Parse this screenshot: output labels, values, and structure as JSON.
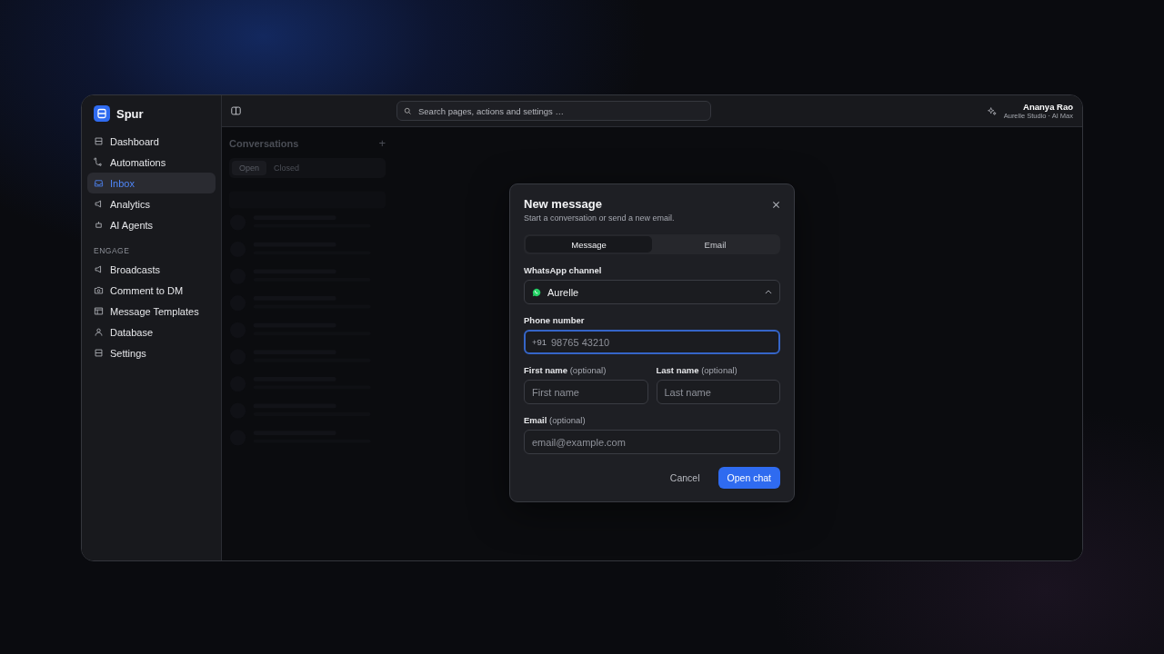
{
  "brand": {
    "name": "Spur"
  },
  "sidebar": {
    "items": [
      {
        "label": "Dashboard",
        "selected": false
      },
      {
        "label": "Automations",
        "selected": false
      },
      {
        "label": "Inbox",
        "selected": true
      },
      {
        "label": "Analytics",
        "selected": false
      },
      {
        "label": "AI Agents",
        "selected": false
      }
    ],
    "section": "ENGAGE",
    "engage_items": [
      {
        "label": "Broadcasts",
        "selected": false
      },
      {
        "label": "Comment to DM",
        "selected": false
      },
      {
        "label": "Message Templates",
        "selected": false
      },
      {
        "label": "Database",
        "selected": false
      },
      {
        "label": "Settings",
        "selected": false
      }
    ]
  },
  "search": {
    "placeholder": "Search pages, actions and settings …"
  },
  "user": {
    "name": "Ananya Rao",
    "subtitle": "Aurelle Studio · AI Max"
  },
  "conversations": {
    "title": "Conversations",
    "tabs": [
      {
        "label": "Open",
        "selected": true
      },
      {
        "label": "Closed",
        "selected": false
      }
    ],
    "add_label": "+"
  },
  "dialog": {
    "title": "New message",
    "subtitle": "Start a conversation or send a new email.",
    "tabs": [
      {
        "label": "Message",
        "selected": true
      },
      {
        "label": "Email",
        "selected": false
      }
    ],
    "channel_label": "WhatsApp channel",
    "channel_value": "Aurelle",
    "channel_expanded": true,
    "phone_label": "Phone number",
    "phone_prefix": "+91",
    "phone_placeholder": "98765 43210",
    "first_label": "First name",
    "first_hint": "(optional)",
    "first_placeholder": "First name",
    "last_label": "Last name",
    "last_hint": "(optional)",
    "last_placeholder": "Last name",
    "email_label": "Email",
    "email_hint": "(optional)",
    "email_placeholder": "email@example.com",
    "cancel": "Cancel",
    "submit": "Open chat"
  }
}
